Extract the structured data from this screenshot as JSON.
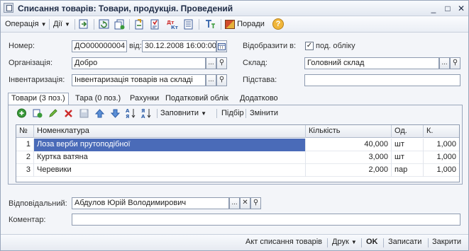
{
  "window": {
    "title": "Списання товарів: Товари, продукція. Проведений",
    "minimize": "_",
    "maximize": "□",
    "close": "✕"
  },
  "toolbar": {
    "operation": "Операція",
    "actions": "Дії",
    "advice": "Поради"
  },
  "form": {
    "number_label": "Номер:",
    "number_value": "ДО000000004",
    "date_label": "від:",
    "date_value": "30.12.2008 16:00:00",
    "reflect_label": "Відобразити в:",
    "tax_check_label": "под. обліку",
    "tax_check_mark": "✓",
    "org_label": "Організація:",
    "org_value": "Добро",
    "warehouse_label": "Склад:",
    "warehouse_value": "Головний склад",
    "inventory_label": "Інвентаризація:",
    "inventory_value": "Інвентаризація товарів на складі",
    "basis_label": "Підстава:",
    "basis_value": "",
    "responsible_label": "Відповідальний:",
    "responsible_value": "Абдулов Юрій Володимирович",
    "comment_label": "Коментар:",
    "comment_value": "",
    "dots": "...",
    "clear": "✕",
    "search": "⚲"
  },
  "tabs": [
    "Товари (3 поз.)",
    "Тара (0 поз.)",
    "Рахунки",
    "Податковий облік",
    "Додатково"
  ],
  "grid_toolbar": {
    "fill": "Заповнити",
    "select": "Підбір",
    "changes": "Змінити"
  },
  "grid": {
    "columns": [
      "№",
      "Номенклатура",
      "Кількість",
      "Од.",
      "К."
    ],
    "rows": [
      {
        "n": "1",
        "name": "Лоза верби прутоподібної",
        "qty": "40,000",
        "unit": "шт",
        "k": "1,000"
      },
      {
        "n": "2",
        "name": "Куртка ватяна",
        "qty": "3,000",
        "unit": "шт",
        "k": "1,000"
      },
      {
        "n": "3",
        "name": "Черевики",
        "qty": "2,000",
        "unit": "пар",
        "k": "1,000"
      }
    ]
  },
  "footer": {
    "act": "Акт списання товарів",
    "print": "Друк",
    "ok": "OK",
    "save": "Записати",
    "close": "Закрити"
  },
  "colors": {
    "selection": "#4a6bb8",
    "accent_green": "#3a9a3a",
    "accent_red": "#cc2b2b"
  }
}
